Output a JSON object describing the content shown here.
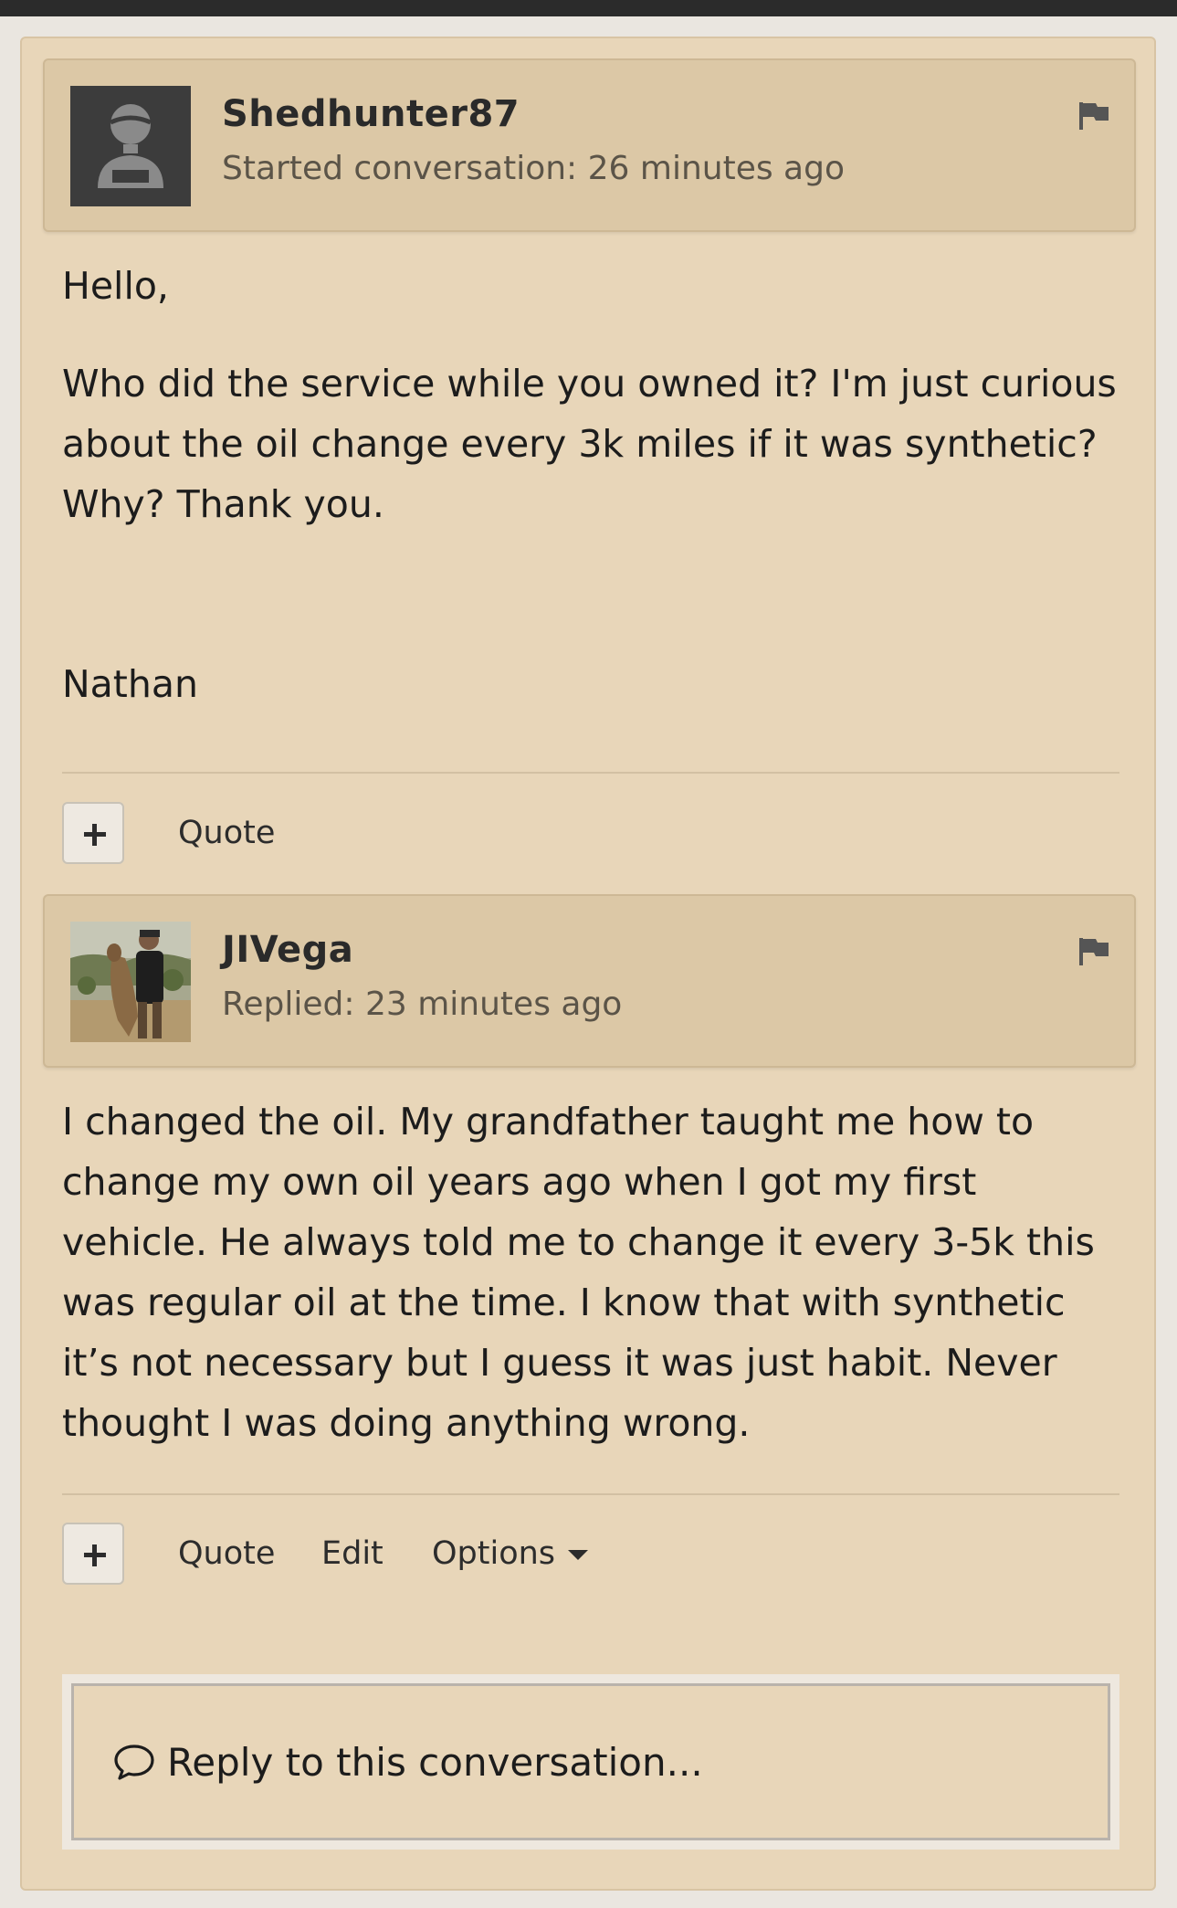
{
  "messages": [
    {
      "username": "Shedhunter87",
      "meta": "Started conversation: 26 minutes ago",
      "avatar": "default-user-silhouette",
      "body": [
        "Hello,",
        "Who did the service while you owned it? I'm just curious about the oil change every 3k miles if it was synthetic? Why? Thank you.",
        "Nathan"
      ],
      "actions": {
        "quote": "Quote"
      }
    },
    {
      "username": "JIVega",
      "meta": "Replied: 23 minutes ago",
      "avatar": "photo-hunter-with-coyote",
      "body": [
        "I changed the oil. My grandfather taught me how to change my own oil years ago when I got my first vehicle. He always told me to change it every 3-5k this was regular oil at the time. I know that with synthetic it’s not necessary but I guess it was just habit. Never thought I was doing anything wrong."
      ],
      "actions": {
        "quote": "Quote",
        "edit": "Edit",
        "options": "Options"
      }
    }
  ],
  "reply": {
    "placeholder": "Reply to this conversation..."
  },
  "icons": {
    "flag": "flag-icon",
    "plus": "plus-icon",
    "caret": "caret-down-icon",
    "speech": "speech-bubble-icon"
  },
  "colors": {
    "panel_bg": "#e8d6b9",
    "header_bg": "#dcc8a6",
    "topbar": "#2b2b2b",
    "text": "#1c1c1c",
    "meta_text": "#5b5448"
  }
}
